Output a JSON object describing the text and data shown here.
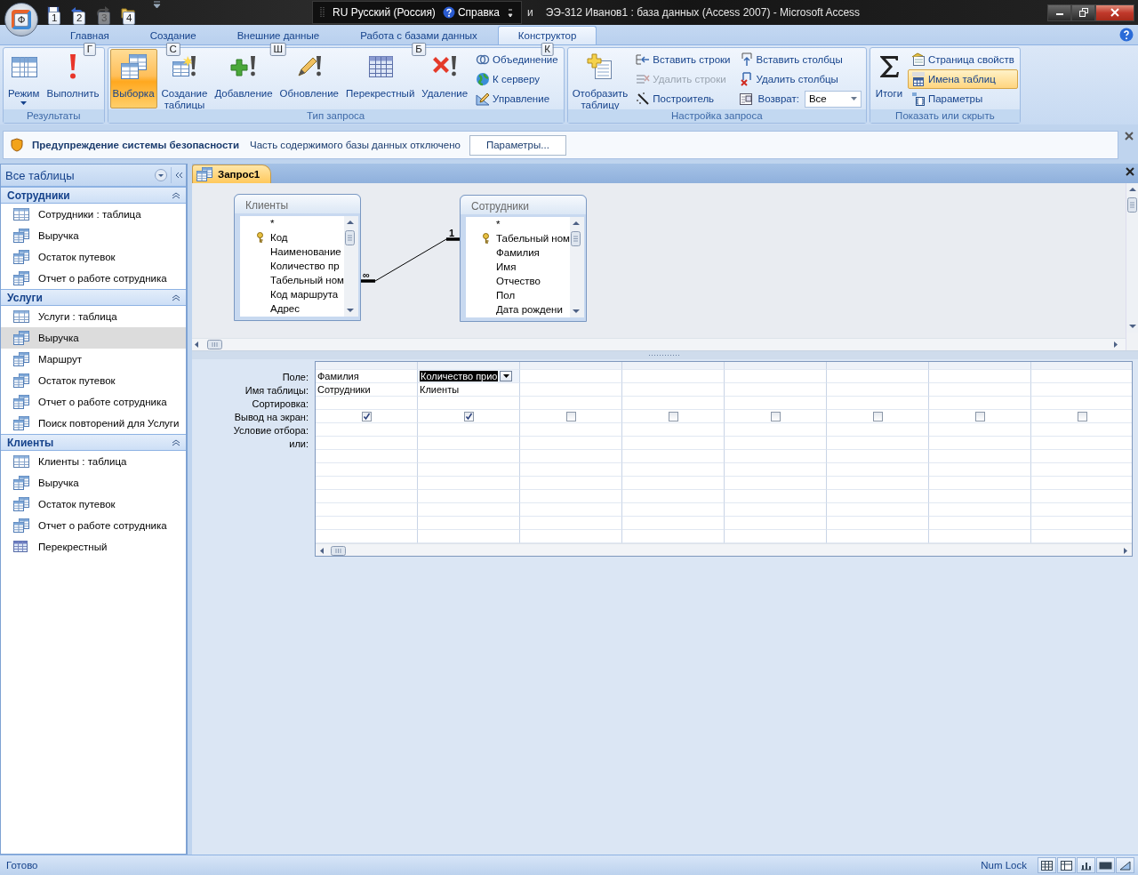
{
  "title_bar": {
    "office_keytip": "Ф",
    "quick_access": [
      {
        "keytip": "1",
        "disabled": false
      },
      {
        "keytip": "2",
        "disabled": false
      },
      {
        "keytip": "3",
        "disabled": true
      },
      {
        "keytip": "4",
        "disabled": false
      }
    ],
    "language": "RU Русский (Россия)",
    "help": "Справка",
    "title_fragment": "и",
    "title": "ЭЭ-312 Иванов1 : база данных (Access 2007)  -  Microsoft Access"
  },
  "ribbon_tabs": [
    {
      "label": "Главная",
      "keytip": "Г",
      "selected": false
    },
    {
      "label": "Создание",
      "keytip": "С",
      "selected": false
    },
    {
      "label": "Внешние данные",
      "keytip": "Ш",
      "selected": false
    },
    {
      "label": "Работа с базами данных",
      "keytip": "Б",
      "selected": false
    },
    {
      "label": "Конструктор",
      "keytip": "К",
      "selected": true
    }
  ],
  "ribbon_groups": [
    {
      "title": "Результаты",
      "large": [
        {
          "label": "Режим",
          "dropdown": true,
          "selected": false
        },
        {
          "label": "Выполнить",
          "selected": false
        }
      ]
    },
    {
      "title": "Тип запроса",
      "large": [
        {
          "label": "Выборка",
          "selected": true
        },
        {
          "label": "Создание таблицы",
          "selected": false
        },
        {
          "label": "Добавление",
          "selected": false
        },
        {
          "label": "Обновление",
          "selected": false
        },
        {
          "label": "Перекрестный",
          "selected": false
        },
        {
          "label": "Удаление",
          "selected": false
        }
      ],
      "columns": [
        [
          {
            "kind": "button",
            "label": "Объединение",
            "disabled": false,
            "selected": false
          },
          {
            "kind": "button",
            "label": "К серверу",
            "disabled": false,
            "selected": false
          },
          {
            "kind": "button",
            "label": "Управление",
            "disabled": false,
            "selected": false
          }
        ]
      ]
    },
    {
      "title": "Настройка запроса",
      "large": [
        {
          "label": "Отобразить таблицу",
          "selected": false
        }
      ],
      "columns": [
        [
          {
            "kind": "button",
            "label": "Вставить строки",
            "disabled": false,
            "selected": false
          },
          {
            "kind": "button",
            "label": "Удалить строки",
            "disabled": true,
            "selected": false
          },
          {
            "kind": "button",
            "label": "Построитель",
            "disabled": false,
            "selected": false
          }
        ],
        [
          {
            "kind": "button",
            "label": "Вставить столбцы",
            "disabled": false,
            "selected": false
          },
          {
            "kind": "button",
            "label": "Удалить столбцы",
            "disabled": false,
            "selected": false
          },
          {
            "kind": "combo",
            "label": "Возврат:",
            "value": "Все",
            "disabled": false,
            "selected": false
          }
        ]
      ]
    },
    {
      "title": "Показать или скрыть",
      "large": [
        {
          "label": "Итоги",
          "selected": false
        }
      ],
      "columns": [
        [
          {
            "kind": "button",
            "label": "Страница свойств",
            "disabled": false,
            "selected": false
          },
          {
            "kind": "button",
            "label": "Имена таблиц",
            "disabled": false,
            "selected": true
          },
          {
            "kind": "button",
            "label": "Параметры",
            "disabled": false,
            "selected": false
          }
        ]
      ]
    }
  ],
  "security_bar": {
    "title": "Предупреждение системы безопасности",
    "message": "Часть содержимого базы данных отключено",
    "button": "Параметры..."
  },
  "navigation": {
    "header": "Все таблицы",
    "groups": [
      {
        "title": "Сотрудники",
        "expanded": true,
        "items": [
          {
            "kind": "table",
            "label": "Сотрудники : таблица",
            "selected": false
          },
          {
            "kind": "query",
            "label": "Выручка",
            "selected": false
          },
          {
            "kind": "query",
            "label": "Остаток путевок",
            "selected": false
          },
          {
            "kind": "query",
            "label": "Отчет о работе сотрудника",
            "selected": false
          }
        ]
      },
      {
        "title": "Услуги",
        "expanded": true,
        "items": [
          {
            "kind": "table",
            "label": "Услуги : таблица",
            "selected": false
          },
          {
            "kind": "query",
            "label": "Выручка",
            "selected": true
          },
          {
            "kind": "query",
            "label": "Маршрут",
            "selected": false
          },
          {
            "kind": "query",
            "label": "Остаток путевок",
            "selected": false
          },
          {
            "kind": "query",
            "label": "Отчет о работе сотрудника",
            "selected": false
          },
          {
            "kind": "query",
            "label": "Поиск повторений для Услуги",
            "selected": false
          }
        ]
      },
      {
        "title": "Клиенты",
        "expanded": true,
        "items": [
          {
            "kind": "table",
            "label": "Клиенты : таблица",
            "selected": false
          },
          {
            "kind": "query",
            "label": "Выручка",
            "selected": false
          },
          {
            "kind": "query",
            "label": "Остаток путевок",
            "selected": false
          },
          {
            "kind": "query",
            "label": "Отчет о работе сотрудника",
            "selected": false
          },
          {
            "kind": "crosstab",
            "label": "Перекрестный",
            "selected": false
          }
        ]
      }
    ]
  },
  "document": {
    "tab": "Запрос1",
    "tables": [
      {
        "title": "Клиенты",
        "fields": [
          {
            "name": "*",
            "key": false
          },
          {
            "name": "Код",
            "key": true
          },
          {
            "name": "Наименование",
            "key": false
          },
          {
            "name": "Количество пр",
            "key": false
          },
          {
            "name": "Табельный ном",
            "key": false
          },
          {
            "name": "Код маршрута",
            "key": false
          },
          {
            "name": "Адрес",
            "key": false
          }
        ]
      },
      {
        "title": "Сотрудники",
        "fields": [
          {
            "name": "*",
            "key": false
          },
          {
            "name": "Табельный ном",
            "key": true
          },
          {
            "name": "Фамилия",
            "key": false
          },
          {
            "name": "Имя",
            "key": false
          },
          {
            "name": "Отчество",
            "key": false
          },
          {
            "name": "Пол",
            "key": false
          },
          {
            "name": "Дата рождени",
            "key": false
          }
        ]
      }
    ],
    "relationship": {
      "many_label": "∞",
      "one_label": "1"
    }
  },
  "grid": {
    "row_labels": [
      "Поле:",
      "Имя таблицы:",
      "Сортировка:",
      "Вывод на экран:",
      "Условие отбора:",
      "или:"
    ],
    "columns": [
      {
        "field": "Фамилия",
        "table": "Сотрудники",
        "show": true,
        "selected": false
      },
      {
        "field": "Количество прио",
        "table": "Клиенты",
        "show": true,
        "selected": true
      },
      {
        "show": false,
        "selected": false
      },
      {
        "show": false,
        "selected": false
      },
      {
        "show": false,
        "selected": false
      },
      {
        "show": false,
        "selected": false
      },
      {
        "show": false,
        "selected": false
      },
      {
        "show": false,
        "selected": false
      }
    ]
  },
  "status_bar": {
    "text": "Готово",
    "indicator": "Num Lock"
  }
}
